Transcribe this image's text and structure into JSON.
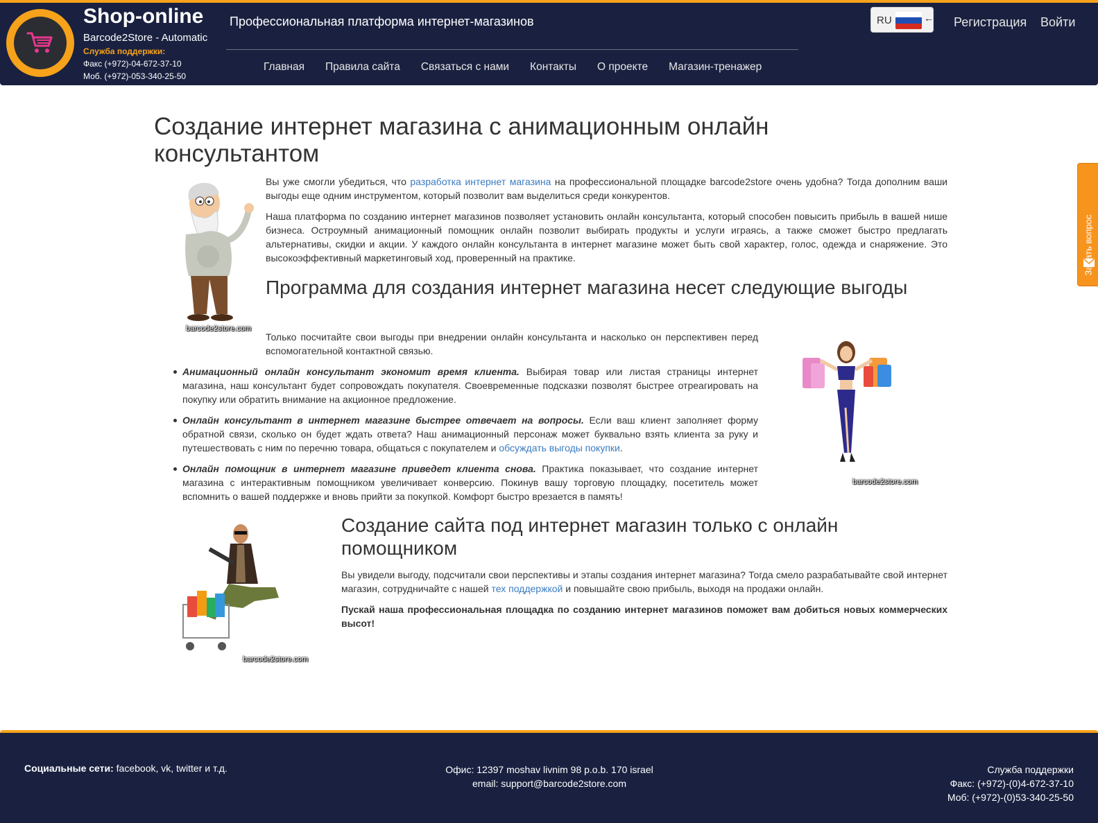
{
  "header": {
    "brand_title": "Shop-online",
    "brand_subtitle": "Barcode2Store - Automatic",
    "support_label": "Служба поддержки:",
    "fax": "Факс (+972)-04-672-37-10",
    "mobile": "Моб. (+972)-053-340-25-50",
    "tagline": "Профессиональная платформа интернет-магазинов",
    "language_code": "RU",
    "register_label": "Регистрация",
    "login_label": "Войти"
  },
  "nav": {
    "items": [
      {
        "label": "Главная"
      },
      {
        "label": "Правила сайта"
      },
      {
        "label": "Связаться с нами"
      },
      {
        "label": "Контакты"
      },
      {
        "label": "О проекте"
      },
      {
        "label": "Магазин-тренажер"
      }
    ]
  },
  "content": {
    "title": "Создание интернет магазина с анимационным онлайн консультантом",
    "p1_before": "Вы уже смогли убедиться, что ",
    "p1_link": "разработка интернет магазина",
    "p1_after": " на профессиональной площадке barcode2store очень удобна? Тогда дополним ваши выгоды еще одним инструментом, который позволит вам выделиться среди конкурентов.",
    "p2": "Наша платформа по созданию интернет магазинов позволяет установить онлайн консультанта, который способен повысить прибыль в вашей нише бизнеса. Остроумный анимационный помощник онлайн позволит выбирать продукты и услуги играясь, а также сможет быстро предлагать альтернативы, скидки и акции. У каждого онлайн консультанта в интернет магазине может быть свой характер, голос, одежда и снаряжение. Это высокоэффективный маркетинговый ход, проверенный на практике.",
    "h2_benefits": "Программа для создания интернет магазина несет следующие выгоды",
    "p3": "Только посчитайте свои выгоды при внедрении онлайн консультанта и насколько он перспективен перед вспомогательной контактной связью.",
    "bullets": [
      {
        "bold": "Анимационный онлайн консультант экономит время клиента.",
        "text": " Выбирая товар или листая страницы интернет магазина, наш консультант будет сопровождать покупателя. Своевременные подсказки позволят быстрее отреагировать на покупку или обратить внимание на акционное предложение.",
        "link": "",
        "tail": ""
      },
      {
        "bold": "Онлайн консультант в интернет магазине быстрее отвечает на вопросы.",
        "text": " Если ваш клиент заполняет форму обратной связи, сколько он будет ждать ответа? Наш анимационный персонаж может буквально взять клиента за руку и путешествовать с ним по перечню товара, общаться с покупателем и ",
        "link": "обсуждать выгоды покупки",
        "tail": "."
      },
      {
        "bold": "Онлайн помощник в интернет магазине приведет клиента снова.",
        "text": " Практика показывает, что создание интернет магазина с интерактивным помощником увеличивает конверсию. Покинув вашу торговую площадку, посетитель может вспомнить о вашей поддержке и вновь прийти за покупкой. Комфорт быстро врезается в память!",
        "link": "",
        "tail": ""
      }
    ],
    "h2_site": "Создание сайта под интернет магазин только с онлайн помощником",
    "p4_before": "Вы увидели выгоду, подсчитали свои перспективы и этапы создания интернет магазина? Тогда смело разрабатывайте свой интернет магазин, сотрудничайте с нашей ",
    "p4_link": "тех поддержкой",
    "p4_after": " и повышайте свою прибыль, выходя на продажи онлайн.",
    "p5": "Пускай наша профессиональная площадка по созданию интернет магазинов поможет вам добиться новых коммерческих высот!",
    "image_caption": "barcode2store.com"
  },
  "side_tab": {
    "label": "Задать вопрос"
  },
  "footer": {
    "social_label": "Социальные сети:",
    "social_text": " facebook, vk, twitter и т.д.",
    "office": "Офис: 12397 moshav livnim 98 p.o.b. 170 israel",
    "email": "email: support@barcode2store.com",
    "support_title": "Служба поддержки",
    "fax": "Факс: (+972)-(0)4-672-37-10",
    "mobile": "Моб: (+972)-(0)53-340-25-50"
  },
  "colors": {
    "header_bg": "#1a2140",
    "accent_orange": "#f7a21b",
    "link_blue": "#3a7bc0",
    "side_tab_orange": "#f7941d",
    "cart_pink": "#e8378f"
  },
  "icons": [
    "shopping-cart-icon",
    "russian-flag-icon",
    "arrow-left-icon",
    "envelope-icon"
  ]
}
